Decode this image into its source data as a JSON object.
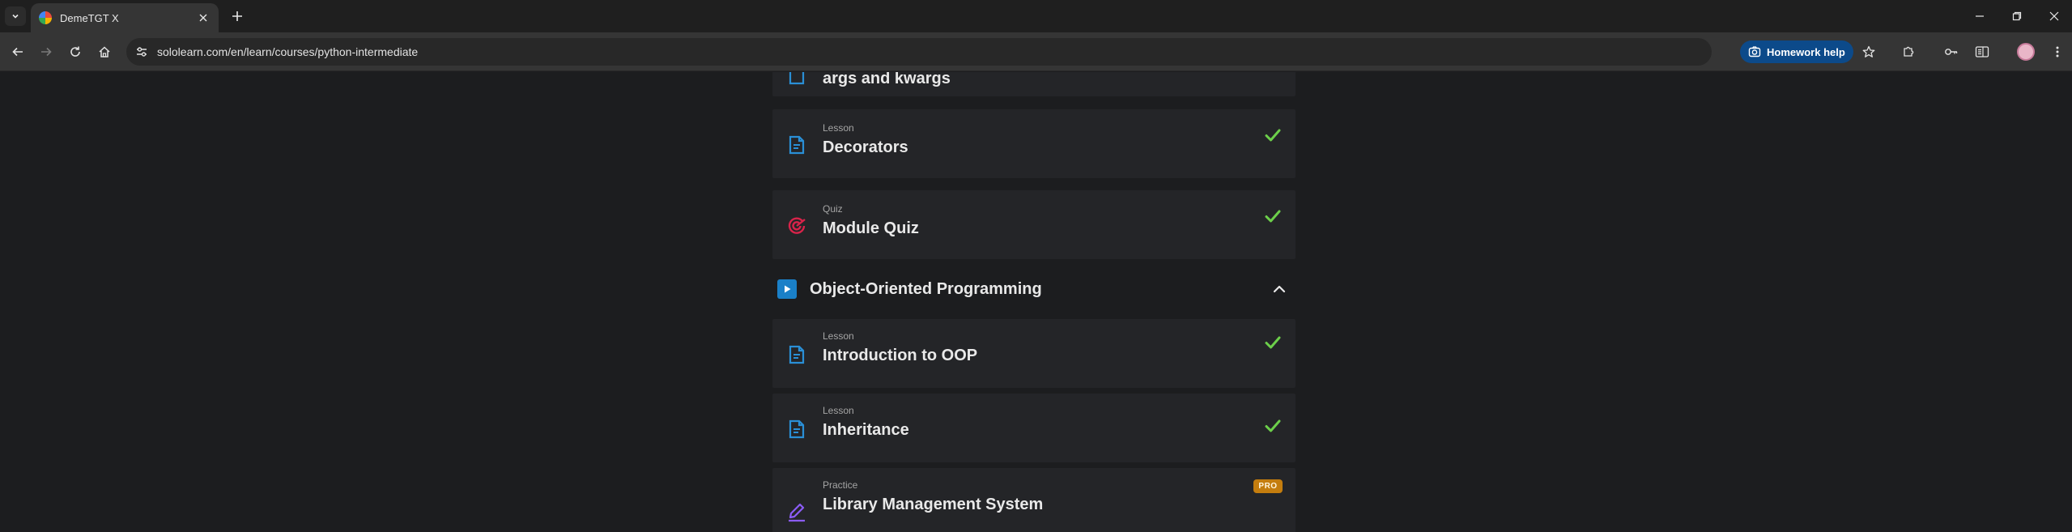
{
  "browser": {
    "tab_title": "DemeTGT X",
    "url": "sololearn.com/en/learn/courses/python-intermediate",
    "homework_help_label": "Homework help"
  },
  "course": {
    "items_top": [
      {
        "type": "",
        "title": "args and kwargs",
        "status": "none"
      },
      {
        "type": "Lesson",
        "title": "Decorators",
        "status": "completed",
        "icon": "lesson-icon"
      },
      {
        "type": "Quiz",
        "title": "Module Quiz",
        "status": "completed",
        "icon": "quiz-target-icon"
      }
    ],
    "module": {
      "title": "Object-Oriented Programming",
      "expanded": true,
      "items": [
        {
          "type": "Lesson",
          "title": "Introduction to OOP",
          "status": "completed",
          "icon": "lesson-icon"
        },
        {
          "type": "Lesson",
          "title": "Inheritance",
          "status": "completed",
          "icon": "lesson-icon"
        },
        {
          "type": "Practice",
          "title": "Library Management System",
          "status": "pro",
          "badge": "PRO",
          "icon": "practice-pencil-icon"
        }
      ]
    }
  },
  "colors": {
    "lesson_icon": "#2a8fd6",
    "quiz_icon": "#d9234a",
    "practice_icon": "#8b5cf6",
    "check": "#6ccf4a",
    "pro_badge": "#c47d0e",
    "module_icon": "#1a80c8"
  }
}
